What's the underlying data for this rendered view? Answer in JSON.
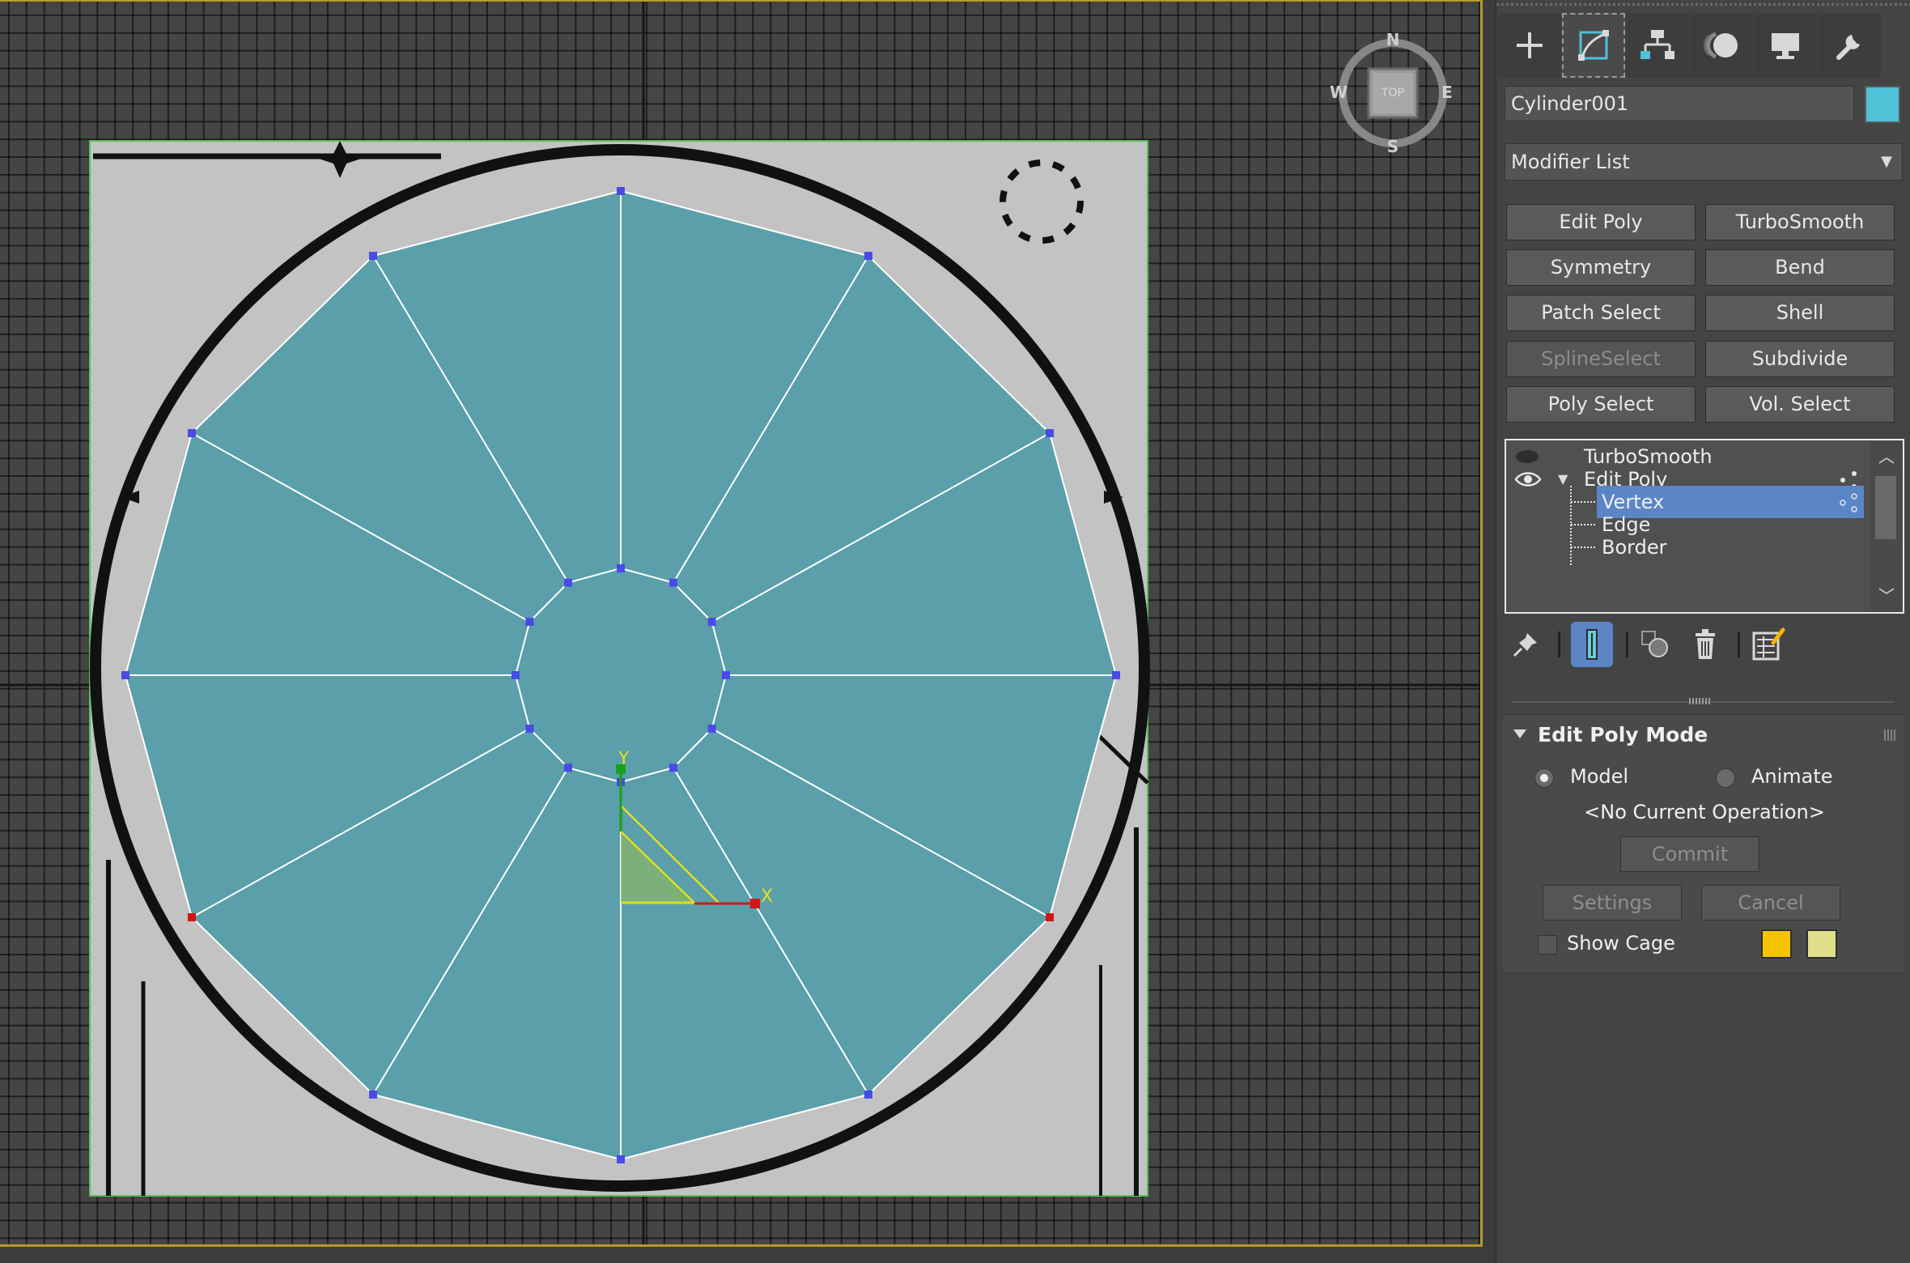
{
  "viewport": {
    "compass": {
      "north": "N",
      "south": "S",
      "east": "E",
      "west": "W",
      "cube_label": "TOP"
    },
    "gizmo": {
      "x_label": "X",
      "y_label": "Y"
    },
    "colors": {
      "mesh": "#5a9fa9",
      "grid_bg": "#454545",
      "border": "#b49a2c"
    }
  },
  "panel": {
    "tabs": [
      {
        "name": "create-tab",
        "icon": "plus-icon"
      },
      {
        "name": "modify-tab",
        "icon": "modify-curve-icon"
      },
      {
        "name": "hierarchy-tab",
        "icon": "hierarchy-icon"
      },
      {
        "name": "motion-tab",
        "icon": "motion-sphere-icon"
      },
      {
        "name": "display-tab",
        "icon": "monitor-icon"
      },
      {
        "name": "utilities-tab",
        "icon": "wrench-icon"
      }
    ],
    "object_name": "Cylinder001",
    "object_color": "#4fc2d8",
    "modifier_list_label": "Modifier List",
    "modifier_buttons": {
      "edit_poly": "Edit Poly",
      "turbosmooth": "TurboSmooth",
      "symmetry": "Symmetry",
      "bend": "Bend",
      "patch_select": "Patch Select",
      "shell": "Shell",
      "spline_select": "SplineSelect",
      "subdivide": "Subdivide",
      "poly_select": "Poly Select",
      "vol_select": "Vol. Select"
    },
    "stack": {
      "turbosmooth": "TurboSmooth",
      "edit_poly": "Edit Poly",
      "vertex": "Vertex",
      "edge": "Edge",
      "border": "Border"
    },
    "rollout": {
      "title": "Edit Poly Mode",
      "model": "Model",
      "animate": "Animate",
      "status": "<No Current Operation>",
      "commit": "Commit",
      "settings": "Settings",
      "cancel": "Cancel",
      "show_cage": "Show Cage",
      "cage_color_1": "#f5c400",
      "cage_color_2": "#e0e08a"
    }
  }
}
